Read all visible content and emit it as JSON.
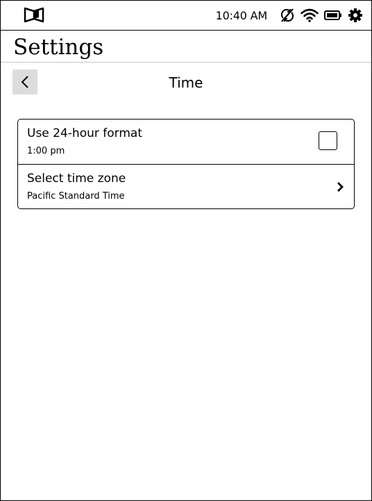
{
  "status_bar": {
    "time": "10:40 AM",
    "icons": [
      "home-book-icon",
      "sync-off-icon",
      "wifi-icon",
      "battery-icon",
      "settings-gear-icon"
    ]
  },
  "header": {
    "title": "Settings"
  },
  "subheader": {
    "title": "Time",
    "back_icon": "chevron-left-icon"
  },
  "settings_card": {
    "rows": [
      {
        "label": "Use 24-hour format",
        "sub": "1:00 pm",
        "control": "checkbox",
        "checked": false
      },
      {
        "label": "Select time zone",
        "sub": "Pacific Standard Time",
        "control": "chevron-right-icon"
      }
    ]
  }
}
